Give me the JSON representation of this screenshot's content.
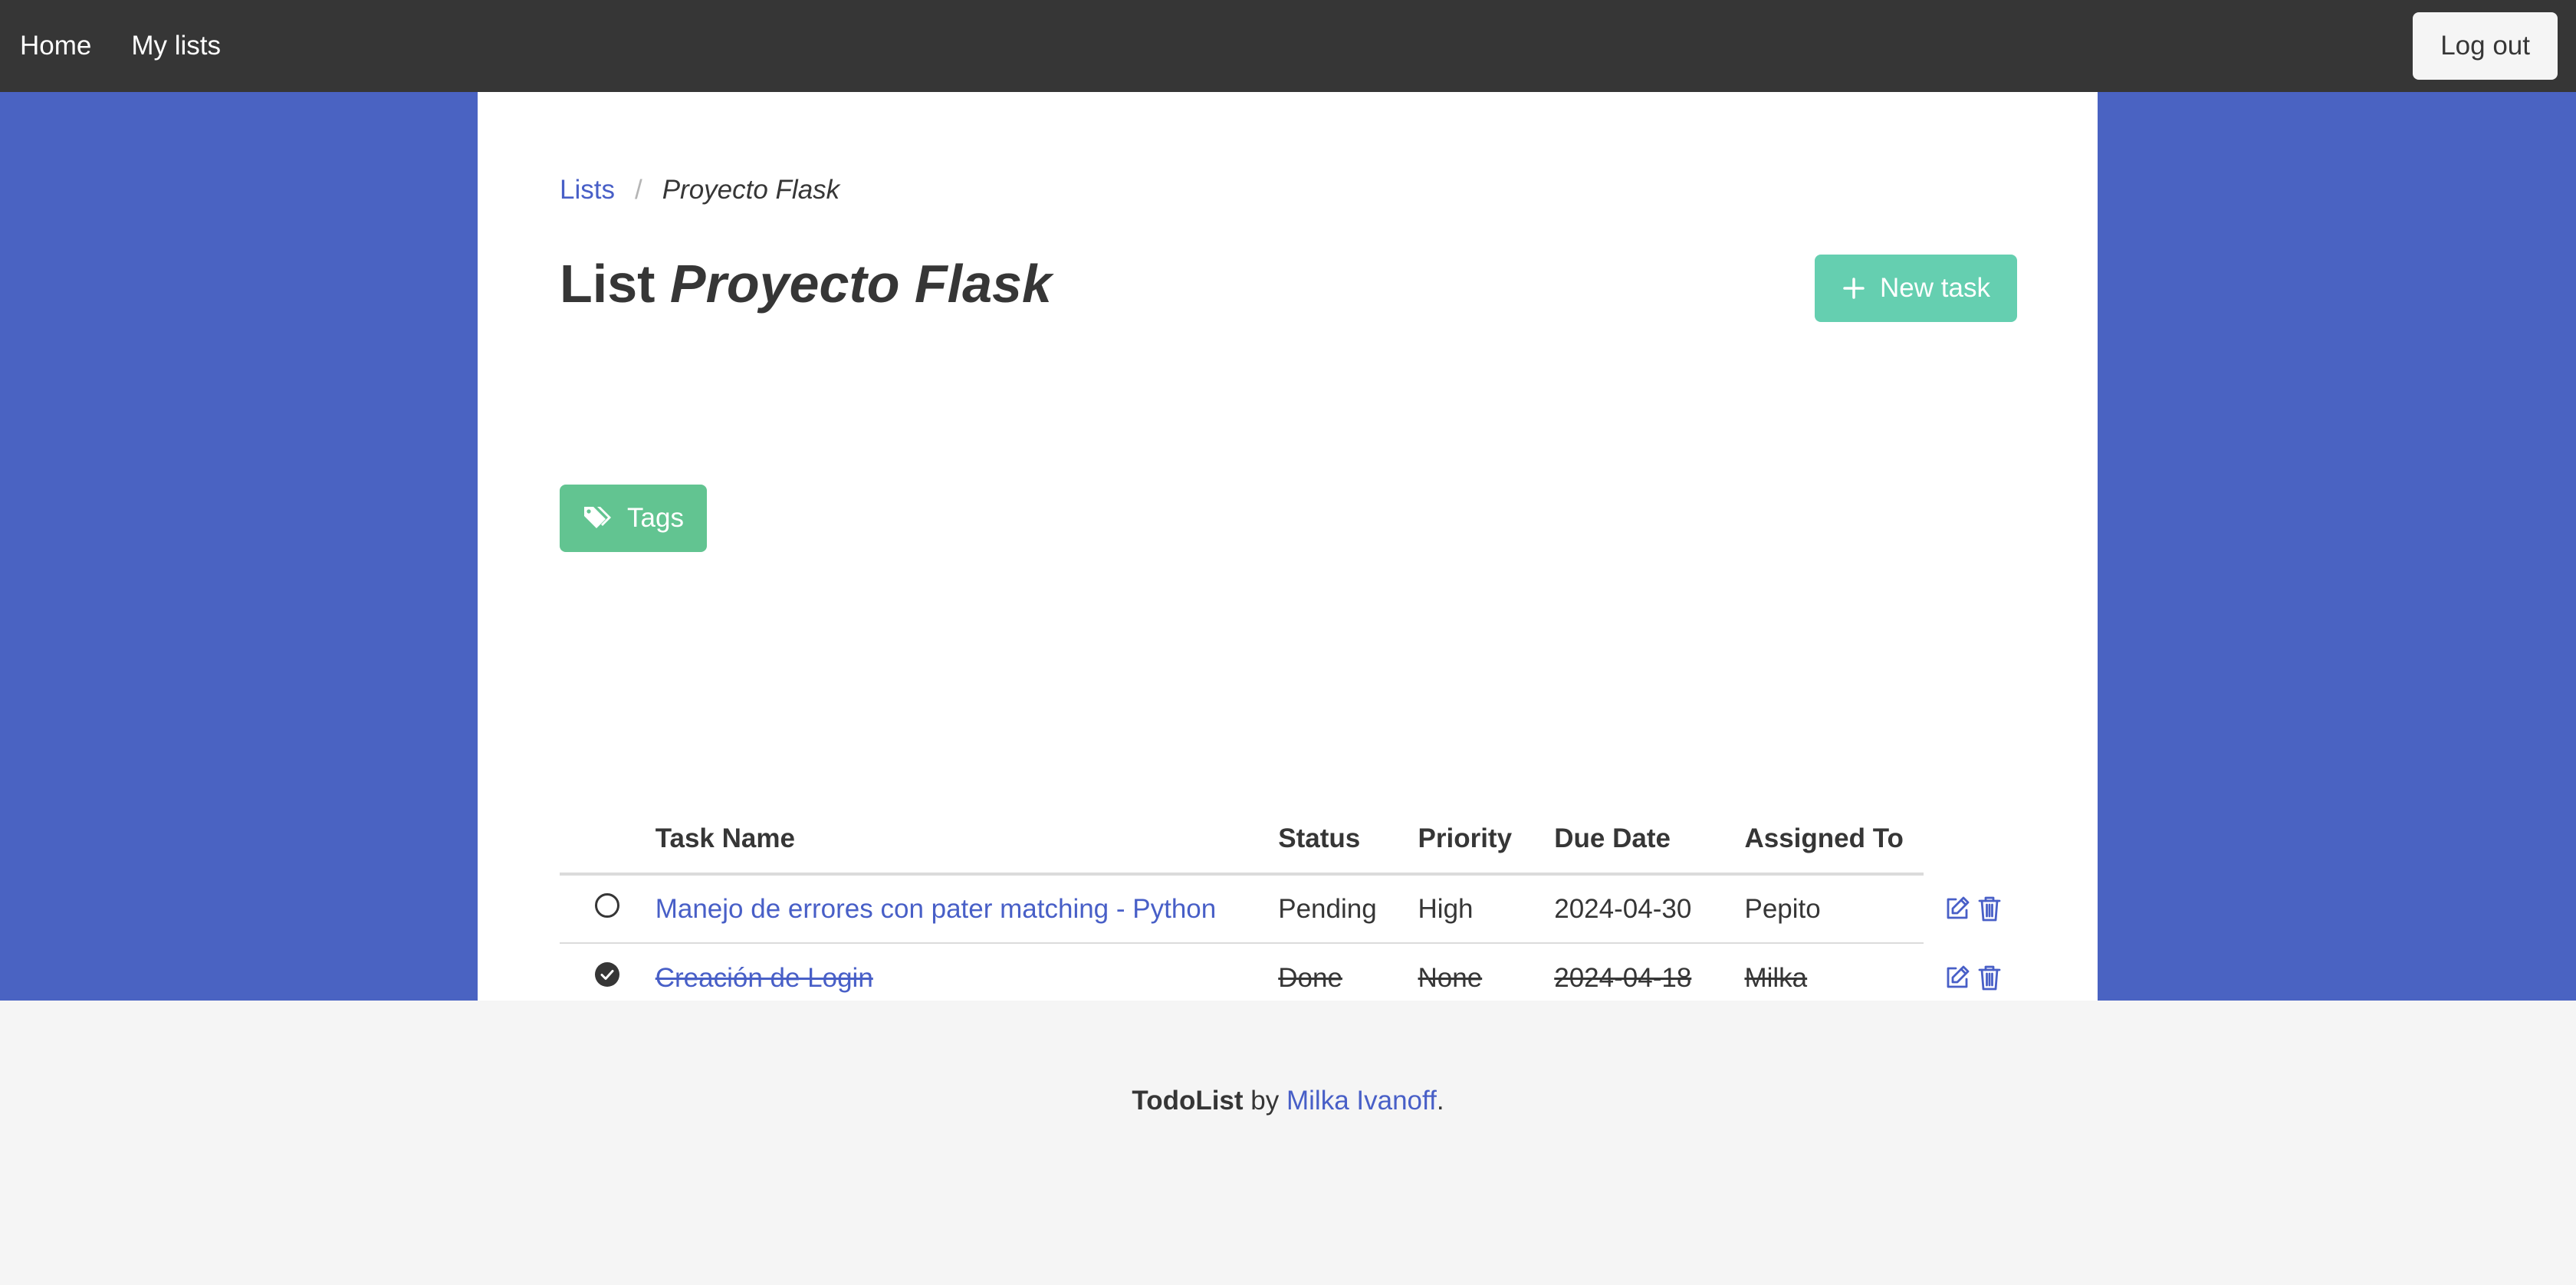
{
  "navbar": {
    "home_label": "Home",
    "my_lists_label": "My lists",
    "logout_label": "Log out"
  },
  "breadcrumb": {
    "lists_label": "Lists",
    "separator": "/",
    "current": "Proyecto Flask"
  },
  "page": {
    "title_prefix": "List",
    "title_name": "Proyecto Flask",
    "new_task_label": "New task",
    "tags_label": "Tags"
  },
  "table": {
    "headers": {
      "task_name": "Task Name",
      "status": "Status",
      "priority": "Priority",
      "due_date": "Due Date",
      "assigned_to": "Assigned To"
    },
    "rows": [
      {
        "done": false,
        "name": "Manejo de errores con pater matching - Python",
        "status": "Pending",
        "priority": "High",
        "due_date": "2024-04-30",
        "assigned_to": "Pepito"
      },
      {
        "done": true,
        "name": "Creación de Login",
        "status": "Done",
        "priority": "None",
        "due_date": "2024-04-18",
        "assigned_to": "Milka"
      }
    ]
  },
  "footer": {
    "app_name": "TodoList",
    "by": "by",
    "author": "Milka Ivanoff",
    "period": "."
  },
  "icons": {
    "unchecked": "circle-icon",
    "checked": "check-circle-icon",
    "edit": "edit-icon",
    "delete": "trash-icon",
    "plus": "plus-icon",
    "tags": "tags-icon"
  },
  "colors": {
    "navbar": "#363636",
    "band": "#4a63c2",
    "link": "#485fc7",
    "new_task_button": "#65cfb0",
    "tags_button": "#62c491",
    "footer": "#f5f5f5"
  }
}
